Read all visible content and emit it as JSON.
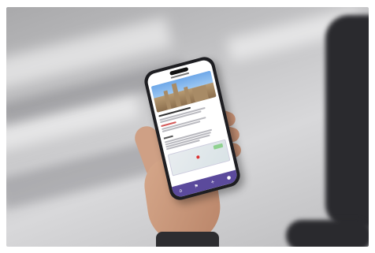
{
  "scene": {
    "background_color": "#c7c7c9",
    "tabbar_color": "#5b4a9c"
  },
  "tabbar": {
    "items": [
      {
        "icon": "home-icon",
        "glyph": "⌂"
      },
      {
        "icon": "map-icon",
        "glyph": "⚑"
      },
      {
        "icon": "plus-icon",
        "glyph": "+"
      },
      {
        "icon": "user-icon",
        "glyph": "●"
      }
    ]
  }
}
